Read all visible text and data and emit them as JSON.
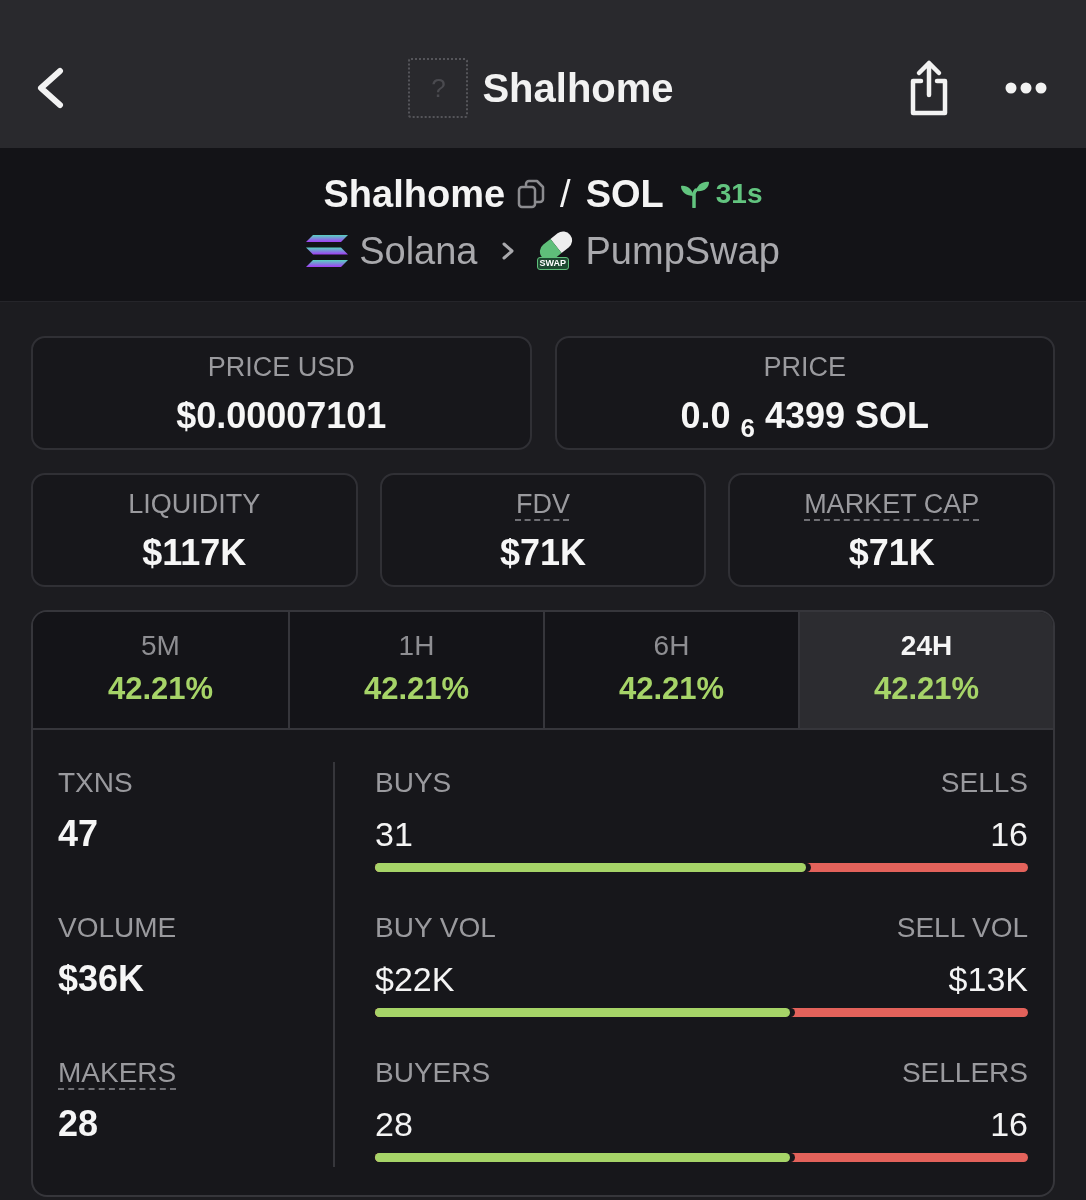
{
  "header": {
    "title": "Shalhome",
    "token_image_placeholder": "?"
  },
  "pair": {
    "base": "Shalhome",
    "separator": "/",
    "quote": "SOL",
    "age": "31s",
    "chain": "Solana",
    "dex": "PumpSwap",
    "dex_logo_text": "SWAP"
  },
  "prices": [
    {
      "label": "PRICE USD",
      "value": "$0.00007101",
      "has_tooltip": false
    },
    {
      "label": "PRICE",
      "value": "0.0 $_{6}$ 4399 SOL",
      "has_tooltip": false
    }
  ],
  "metrics": [
    {
      "label": "LIQUIDITY",
      "value": "$117K",
      "has_tooltip": false
    },
    {
      "label": "FDV",
      "value": "$71K",
      "has_tooltip": true
    },
    {
      "label": "MARKET CAP",
      "value": "$71K",
      "has_tooltip": true
    }
  ],
  "periods": [
    {
      "label": "5M",
      "change": "42.21%",
      "selected": false
    },
    {
      "label": "1H",
      "change": "42.21%",
      "selected": false
    },
    {
      "label": "6H",
      "change": "42.21%",
      "selected": false
    },
    {
      "label": "24H",
      "change": "42.21%",
      "selected": true
    }
  ],
  "stats": [
    {
      "total": {
        "label": "TXNS",
        "value": "47",
        "has_tooltip": false
      },
      "buy": {
        "label": "BUYS",
        "value": "31"
      },
      "sell": {
        "label": "SELLS",
        "value": "16"
      },
      "level": 0.66
    },
    {
      "total": {
        "label": "VOLUME",
        "value": "$36K",
        "has_tooltip": false
      },
      "buy": {
        "label": "BUY VOL",
        "value": "$22K"
      },
      "sell": {
        "label": "SELL VOL",
        "value": "$13K"
      },
      "level": 0.636
    },
    {
      "total": {
        "label": "MAKERS",
        "value": "28",
        "has_tooltip": true
      },
      "buy": {
        "label": "BUYERS",
        "value": "28"
      },
      "sell": {
        "label": "SELLERS",
        "value": "16"
      },
      "level": 0.636
    }
  ]
}
